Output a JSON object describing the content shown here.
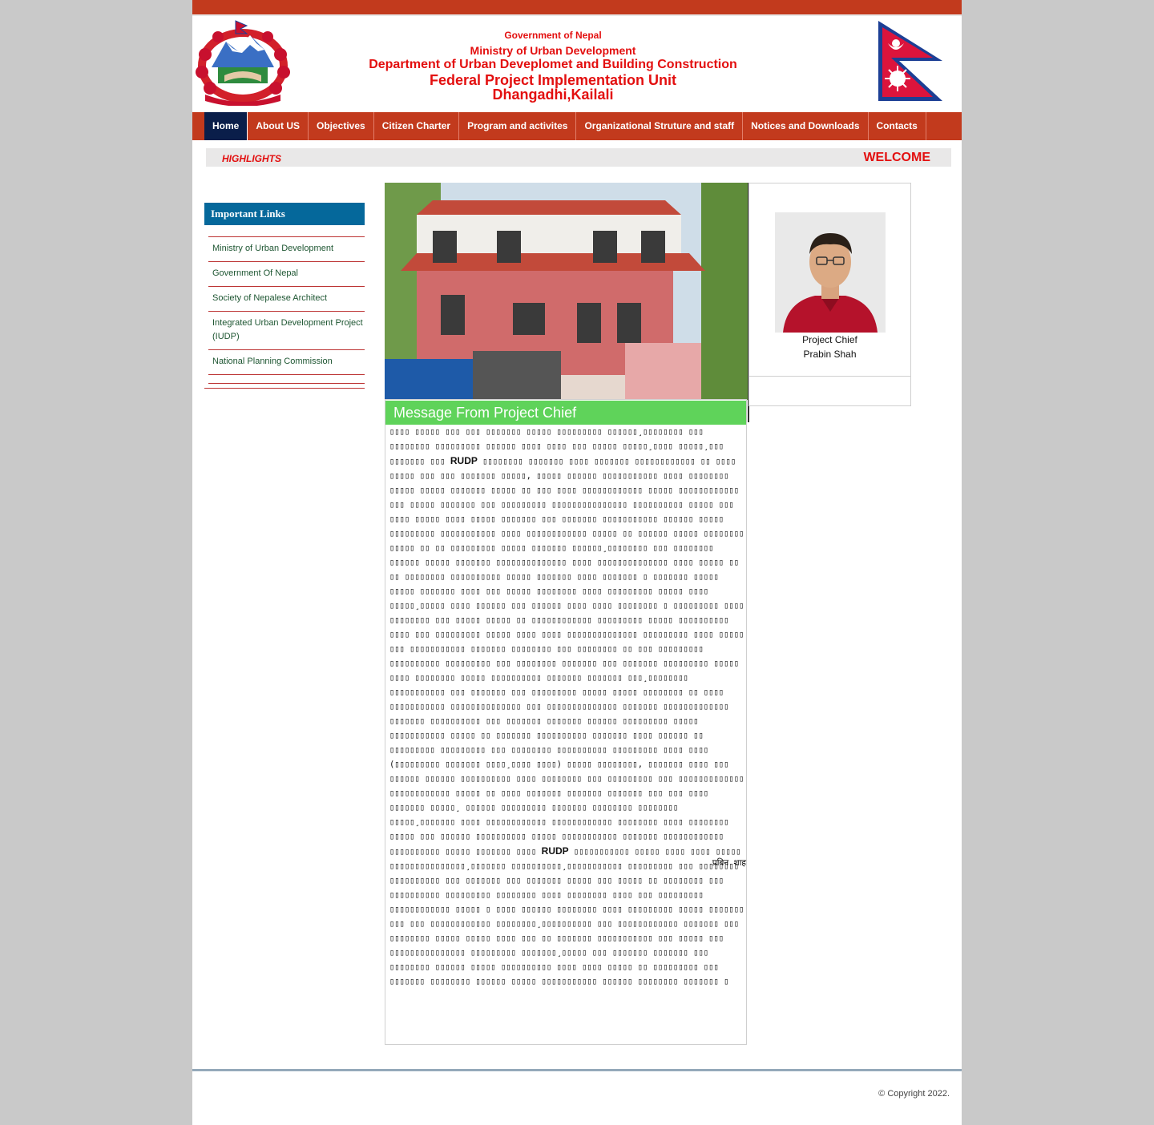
{
  "header": {
    "line1": "Government of Nepal",
    "line2": "Ministry of Urban Development",
    "line3": "Department of Urban Deveplomet and Building Construction",
    "line4": "Federal Project Implementation Unit",
    "line5": "Dhangadhi,Kailali",
    "emblem_icon": "nepal-emblem-icon",
    "flag_icon": "nepal-flag-icon"
  },
  "nav": {
    "items": [
      {
        "label": "Home"
      },
      {
        "label": "About US"
      },
      {
        "label": "Objectives"
      },
      {
        "label": "Citizen Charter"
      },
      {
        "label": "Program and activites"
      },
      {
        "label": "Organizational Struture and staff"
      },
      {
        "label": "Notices and Downloads"
      },
      {
        "label": "Contacts"
      }
    ],
    "active_label": "Home"
  },
  "highlights": {
    "label": "HIGHLIGHTS",
    "welcome": "WELCOME"
  },
  "sidebar": {
    "title": "Important Links",
    "links": [
      {
        "label": "Ministry of Urban Development"
      },
      {
        "label": "Government Of Nepal"
      },
      {
        "label": "Society of Nepalese Architect"
      },
      {
        "label": "Integrated Urban Development Project (IUDP)"
      },
      {
        "label": "National Planning Commission"
      }
    ]
  },
  "message": {
    "title": "Message From Project Chief",
    "abbr": "RUDP",
    "signature": "प्रबिन शाह"
  },
  "chief": {
    "role": "Project Chief",
    "name": "Prabin Shah"
  },
  "footer": {
    "copyright": "© Copyright 2022."
  },
  "colors": {
    "brand_red": "#c23a1d",
    "nav_active": "#0a1e4a",
    "sidebar_head": "#05689b",
    "message_head": "#5fd35a",
    "header_text": "#e30f0f"
  }
}
